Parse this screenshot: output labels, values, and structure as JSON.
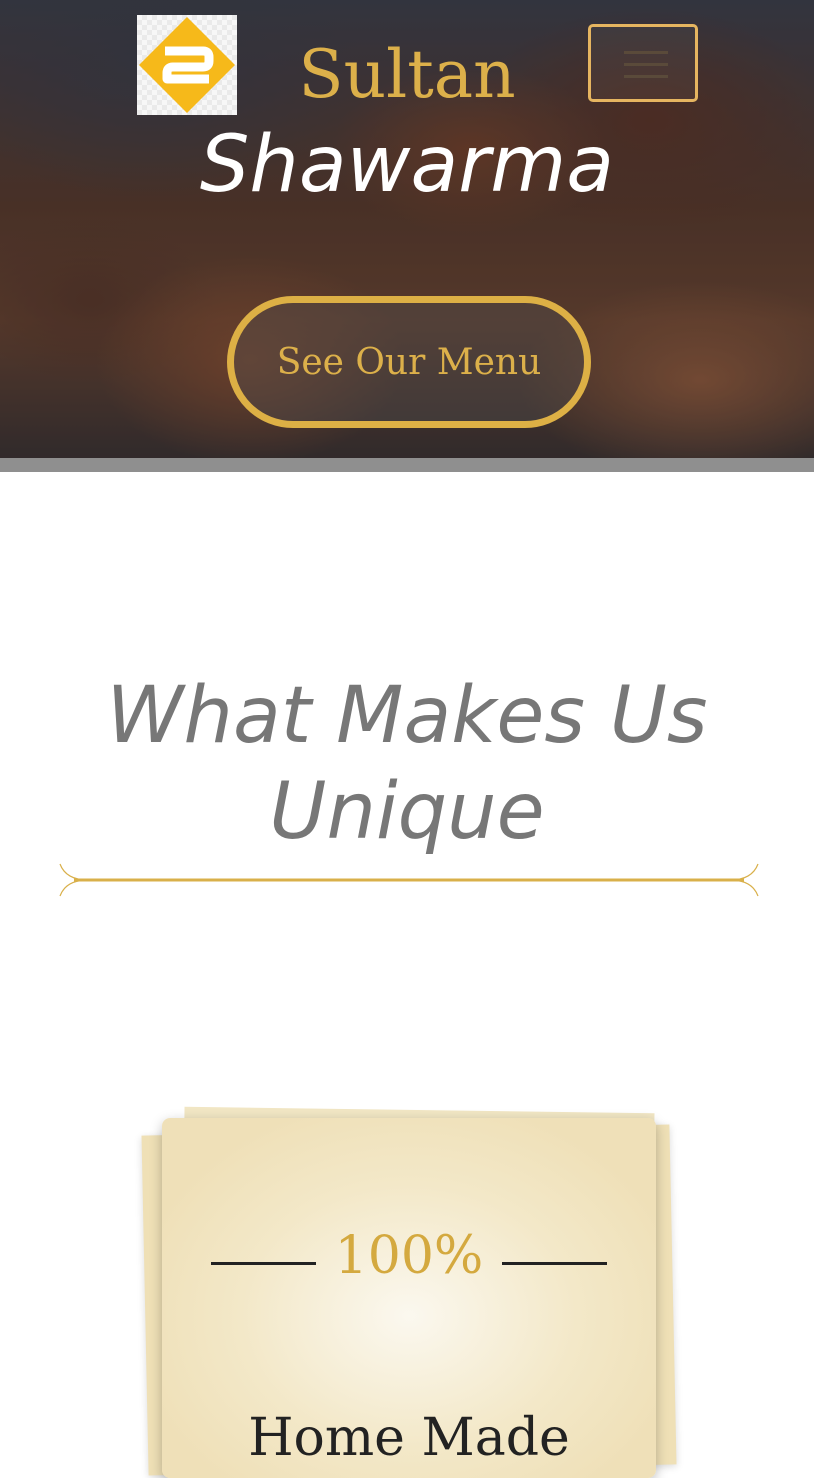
{
  "header": {
    "logo_icon": "logo-2-diamond-icon",
    "brand_line1": "Sultan",
    "brand_line2": "Shawarma",
    "menu_icon": "hamburger-icon",
    "cta_label": "See Our Menu"
  },
  "unique_section": {
    "title_line1": "What Makes Us",
    "title_line2": "Unique"
  },
  "feature_card": {
    "percent": "100%",
    "label": "Home Made"
  },
  "colors": {
    "gold": "#dcb04a",
    "menu_border": "#e6b560",
    "title_gray": "#777777",
    "card_bg": "#f3e8c8"
  }
}
